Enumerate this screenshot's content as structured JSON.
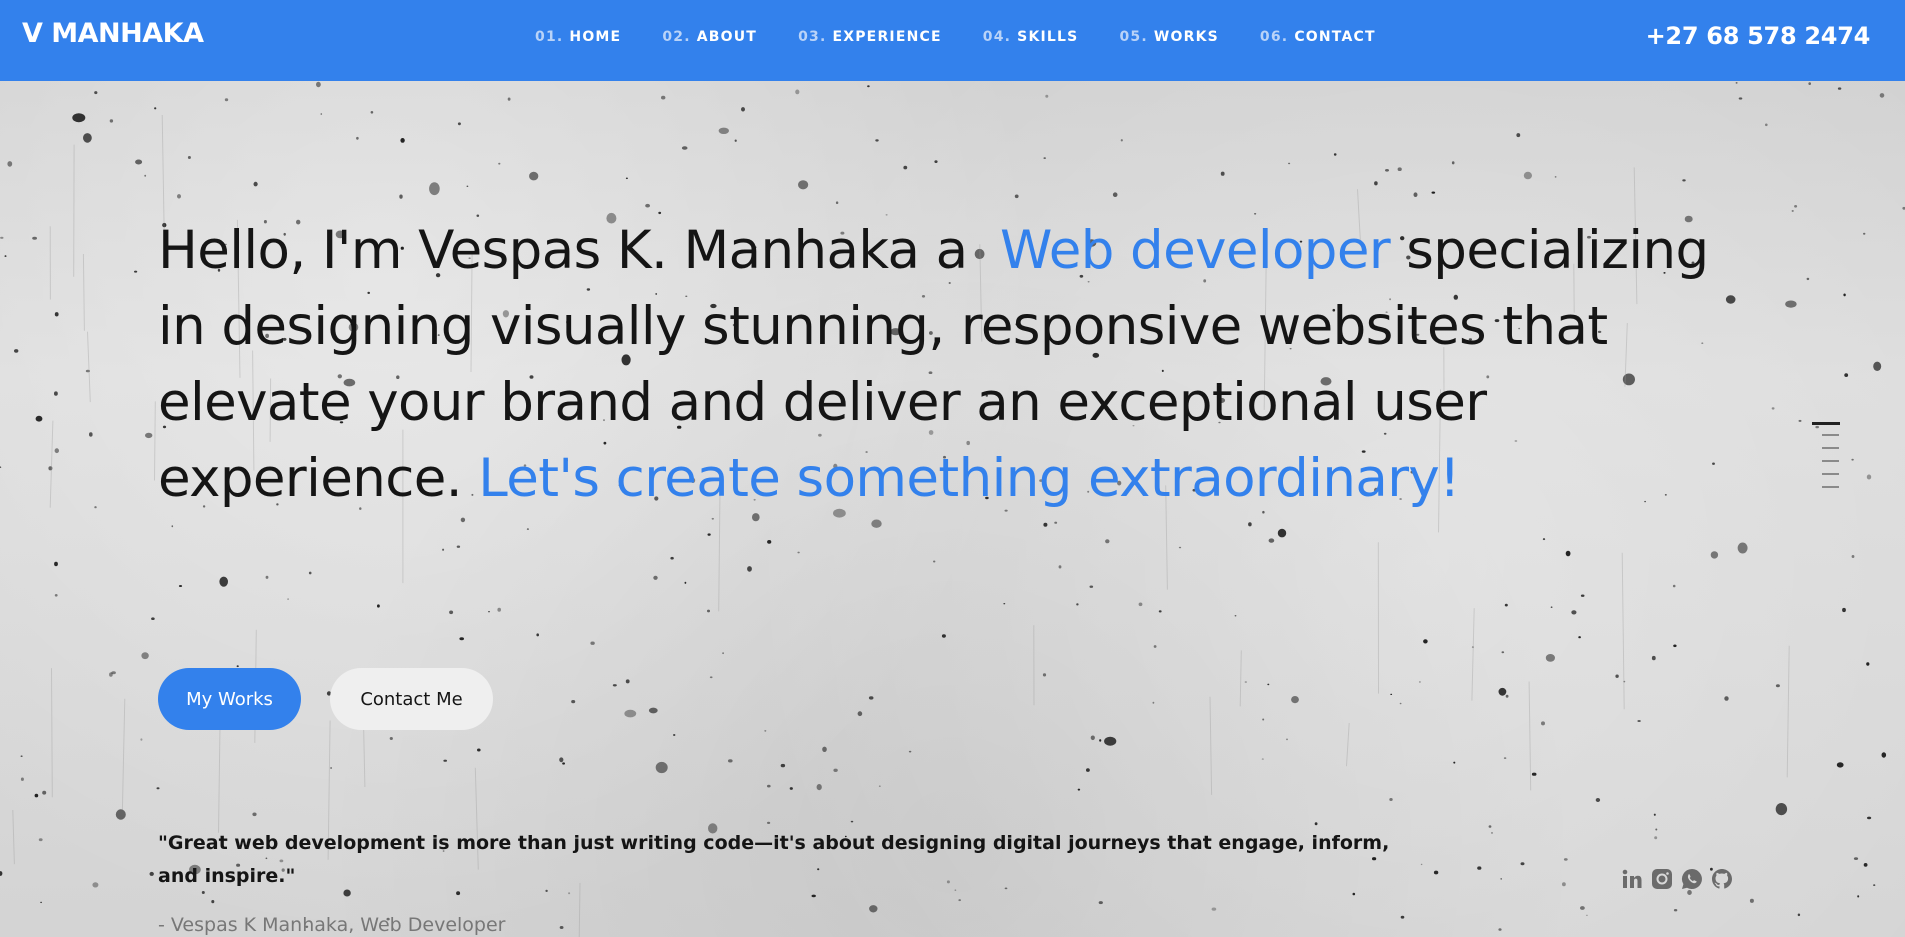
{
  "header": {
    "logo": "V MANHAKA",
    "phone": "+27 68 578 2474",
    "nav": [
      {
        "num": "01.",
        "label": "HOME"
      },
      {
        "num": "02.",
        "label": "ABOUT"
      },
      {
        "num": "03.",
        "label": "EXPERIENCE"
      },
      {
        "num": "04.",
        "label": "SKILLS"
      },
      {
        "num": "05.",
        "label": "WORKS"
      },
      {
        "num": "06.",
        "label": "CONTACT"
      }
    ]
  },
  "hero": {
    "line1_a": "Hello, I'm Vespas K. Manhaka a ",
    "line1_accent": "Web developer",
    "body": "specializing in designing visually stunning, responsive websites that elevate your brand and deliver an exceptional user experience. ",
    "cta_accent": "Let's create something extraordinary!",
    "primary_button": "My Works",
    "secondary_button": "Contact Me",
    "quote": "\"Great web development is more than just writing code—it's about designing digital journeys that engage, inform, and inspire.\"",
    "attribution": "- Vespas K Manhaka, Web Developer"
  },
  "side_indicator": {
    "count": 6,
    "active_index": 0
  },
  "socials": [
    "linkedin-icon",
    "instagram-icon",
    "whatsapp-icon",
    "github-icon"
  ],
  "colors": {
    "accent": "#3381ec",
    "text": "#151515",
    "muted": "#777777"
  }
}
